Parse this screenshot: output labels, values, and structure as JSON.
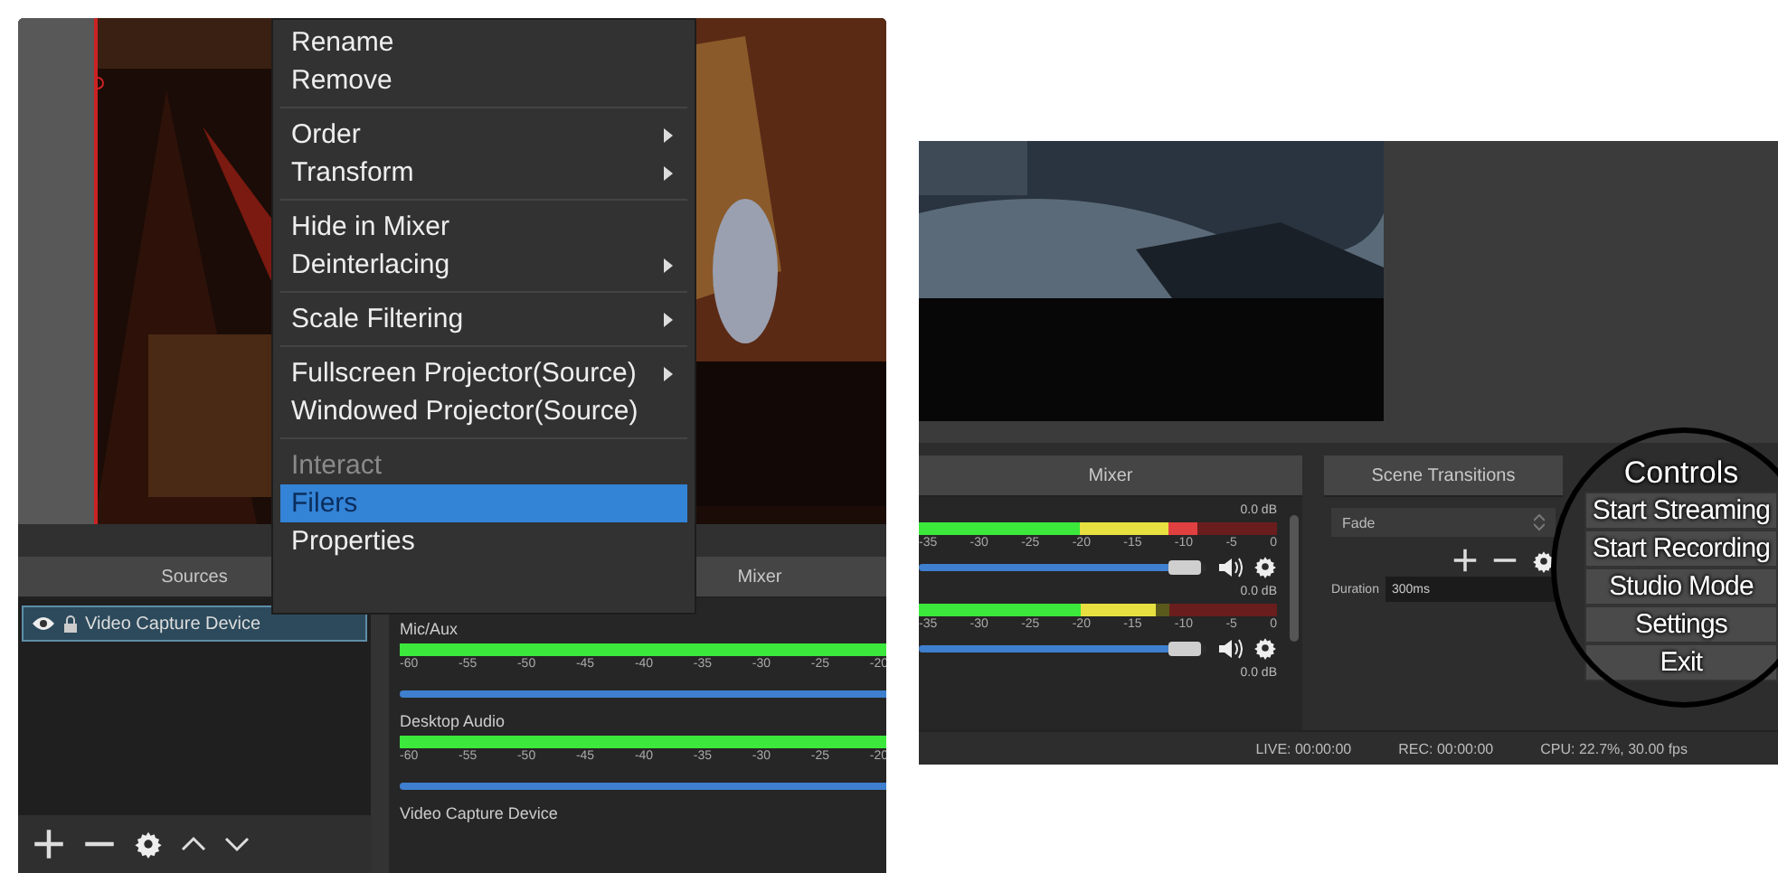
{
  "left_screenshot": {
    "context_menu": {
      "groups": [
        [
          {
            "label": "Rename",
            "submenu": false,
            "disabled": false,
            "selected": false
          },
          {
            "label": "Remove",
            "submenu": false,
            "disabled": false,
            "selected": false
          }
        ],
        [
          {
            "label": "Order",
            "submenu": true,
            "disabled": false,
            "selected": false
          },
          {
            "label": "Transform",
            "submenu": true,
            "disabled": false,
            "selected": false
          }
        ],
        [
          {
            "label": "Hide in Mixer",
            "submenu": false,
            "disabled": false,
            "selected": false
          },
          {
            "label": "Deinterlacing",
            "submenu": true,
            "disabled": false,
            "selected": false
          }
        ],
        [
          {
            "label": "Scale Filtering",
            "submenu": true,
            "disabled": false,
            "selected": false
          }
        ],
        [
          {
            "label": "Fullscreen Projector(Source)",
            "submenu": true,
            "disabled": false,
            "selected": false
          },
          {
            "label": "Windowed Projector(Source)",
            "submenu": false,
            "disabled": false,
            "selected": false
          }
        ],
        [
          {
            "label": "Interact",
            "submenu": false,
            "disabled": true,
            "selected": false
          },
          {
            "label": "Filers",
            "submenu": false,
            "disabled": false,
            "selected": true
          },
          {
            "label": "Properties",
            "submenu": false,
            "disabled": false,
            "selected": false
          }
        ]
      ]
    },
    "sources": {
      "title": "Sources",
      "items": [
        {
          "name": "Video Capture Device",
          "visible": true,
          "locked": true,
          "selected": true
        }
      ]
    },
    "mixer": {
      "title": "Mixer",
      "channels": [
        {
          "name": "Mic/Aux",
          "meter": {
            "level": 1
          },
          "fader": {
            "level": 1
          },
          "scale": [
            "-60",
            "-55",
            "-50",
            "-45",
            "-40",
            "-35",
            "-30",
            "-25",
            "-20"
          ]
        },
        {
          "name": "Desktop Audio",
          "meter": {
            "level": 1
          },
          "fader": {
            "level": 1
          },
          "scale": [
            "-60",
            "-55",
            "-50",
            "-45",
            "-40",
            "-35",
            "-30",
            "-25",
            "-20"
          ]
        },
        {
          "name": "Video Capture Device"
        }
      ]
    }
  },
  "right_screenshot": {
    "mixer": {
      "title": "Mixer",
      "channels": [
        {
          "reading": "0.0 dB",
          "meter": {
            "level": 0.78
          },
          "fader": {
            "level": 0.88
          },
          "muted": false,
          "scale": [
            "-35",
            "-30",
            "-25",
            "-20",
            "-15",
            "-10",
            "-5",
            "0"
          ]
        },
        {
          "reading": "0.0 dB",
          "meter": {
            "level": 0.66
          },
          "fader": {
            "level": 0.88
          },
          "muted": false,
          "scale": [
            "-35",
            "-30",
            "-25",
            "-20",
            "-15",
            "-10",
            "-5",
            "0"
          ]
        },
        {
          "reading": "0.0 dB"
        }
      ]
    },
    "scene_transitions": {
      "title": "Scene Transitions",
      "transition": "Fade",
      "duration_label": "Duration",
      "duration": "300ms"
    },
    "controls": {
      "title": "Controls",
      "buttons": [
        "Start Streaming",
        "Start Recording",
        "Studio Mode",
        "Settings",
        "Exit"
      ]
    },
    "status_bar": [
      "LIVE: 00:00:00",
      "REC: 00:00:00",
      "CPU: 22.7%, 30.00 fps"
    ]
  }
}
